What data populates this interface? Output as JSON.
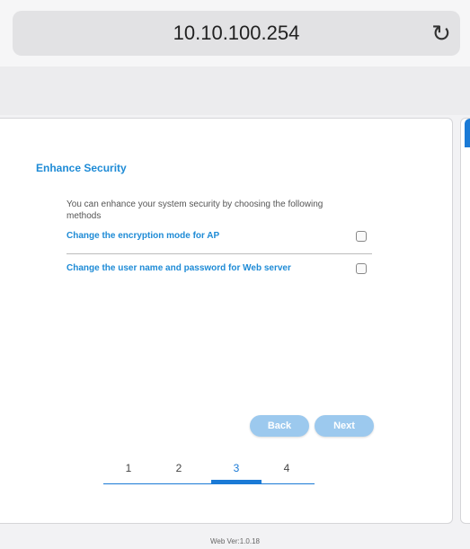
{
  "browser": {
    "url": "10.10.100.254",
    "reload_icon": "reload-icon"
  },
  "wizard": {
    "title": "Enhance Security",
    "description": "You can enhance your system security by choosing the following methods",
    "options": [
      {
        "label": "Change the encryption mode for AP",
        "checked": false
      },
      {
        "label": "Change the user name and password for Web server",
        "checked": false
      }
    ],
    "back_label": "Back",
    "next_label": "Next",
    "steps": [
      "1",
      "2",
      "3",
      "4"
    ],
    "active_step": "3",
    "accent_color": "#1a7ad6"
  },
  "footer": {
    "version": "Web Ver:1.0.18"
  }
}
